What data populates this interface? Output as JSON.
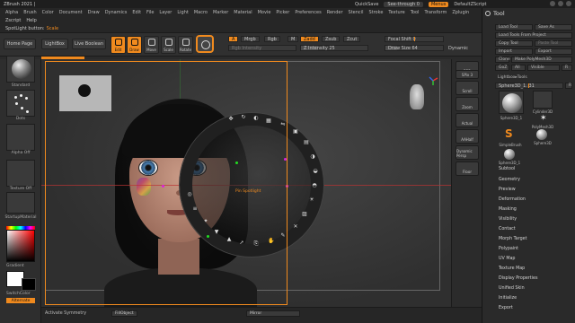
{
  "titlebar": {
    "app": "ZBrush 2021 |",
    "quicksave": "QuickSave",
    "seethrough": "See-through 0",
    "menus": "Menus",
    "script": "DefaultZScript"
  },
  "menubar": [
    "Alpha",
    "Brush",
    "Color",
    "Document",
    "Draw",
    "Dynamics",
    "Edit",
    "File",
    "Layer",
    "Light",
    "Macro",
    "Marker",
    "Material",
    "Movie",
    "Picker",
    "Preferences",
    "Render",
    "Stencil",
    "Stroke",
    "Texture",
    "Tool",
    "Transform",
    "Zplugin"
  ],
  "menubar2": [
    "Zscript",
    "Help"
  ],
  "info": {
    "label": "SpotLight button:",
    "value": "Scale"
  },
  "shelf": {
    "home": "Home Page",
    "lightbox": "LightBox",
    "liveboolean": "Live Boolean",
    "edit": "Edit",
    "draw": "Draw",
    "move": "Move",
    "scale": "Scale",
    "rotate": "Rotate",
    "a": "A",
    "mrgb": "Mrgb",
    "rgb": "Rgb",
    "m": "M",
    "rgb_intensity": "Rgb Intensity",
    "zadd": "Zadd",
    "zsub": "Zsub",
    "zcut": "Zcut",
    "z_intensity": "Z Intensity 25",
    "focal": "Focal Shift 0",
    "drawsize": "Draw Size 64",
    "dynamic": "Dynamic"
  },
  "left": {
    "standard": "Standard",
    "dots": "Dots",
    "alpha_off": "Alpha Off",
    "texture_off": "Texture Off",
    "startup_material": "StartupMaterial",
    "gradient": "Gradient",
    "switchcolor": "SwitchColor",
    "alternate": "Alternate"
  },
  "viewport": {
    "spotlight_label": "Pin Spotlight"
  },
  "rstrip": [
    "BPR",
    "SPix 3",
    "Scroll",
    "Zoom",
    "Actual",
    "AAHalf",
    "Dynamic Persp",
    "Floor"
  ],
  "palette": {
    "title": "Tool",
    "load_tool": "Load Tool",
    "save_as": "Save As",
    "load_from_project": "Load Tools From Project",
    "copy_tool": "Copy Tool",
    "paste_tool": "Paste Tool",
    "import": "Import",
    "export": "Export",
    "clone": "Clone",
    "make_polymesh": "Make PolyMesh3D",
    "goz": "GoZ",
    "all": "All",
    "visible": "Visible",
    "r": "R",
    "lightbox_tools": "Lightbox▸Tools",
    "current_tool": "Sphere3D_1. 31",
    "r2": "R",
    "tools": [
      {
        "label": "Sphere3D_1"
      },
      {
        "label": "Cylinder3D"
      },
      {
        "label": "PolyMesh3D"
      },
      {
        "label": "SimpleBrush"
      },
      {
        "label": "Sphere3D"
      },
      {
        "label": "Sphere3D_1"
      }
    ],
    "sections": [
      "Subtool",
      "Geometry",
      "Preview",
      "Deformation",
      "Masking",
      "Visibility",
      "Contact",
      "Morph Target",
      "Polypaint",
      "UV Map",
      "Texture Map",
      "Display Properties",
      "Unified Skin",
      "Initialize",
      "Export"
    ]
  },
  "bottom": {
    "activate_symmetry": "Activate Symmetry",
    "fill_object": "FillObject",
    "mirror": "Mirror"
  },
  "colors": {
    "accent": "#f08a1e",
    "bg": "#2a2a2a"
  }
}
